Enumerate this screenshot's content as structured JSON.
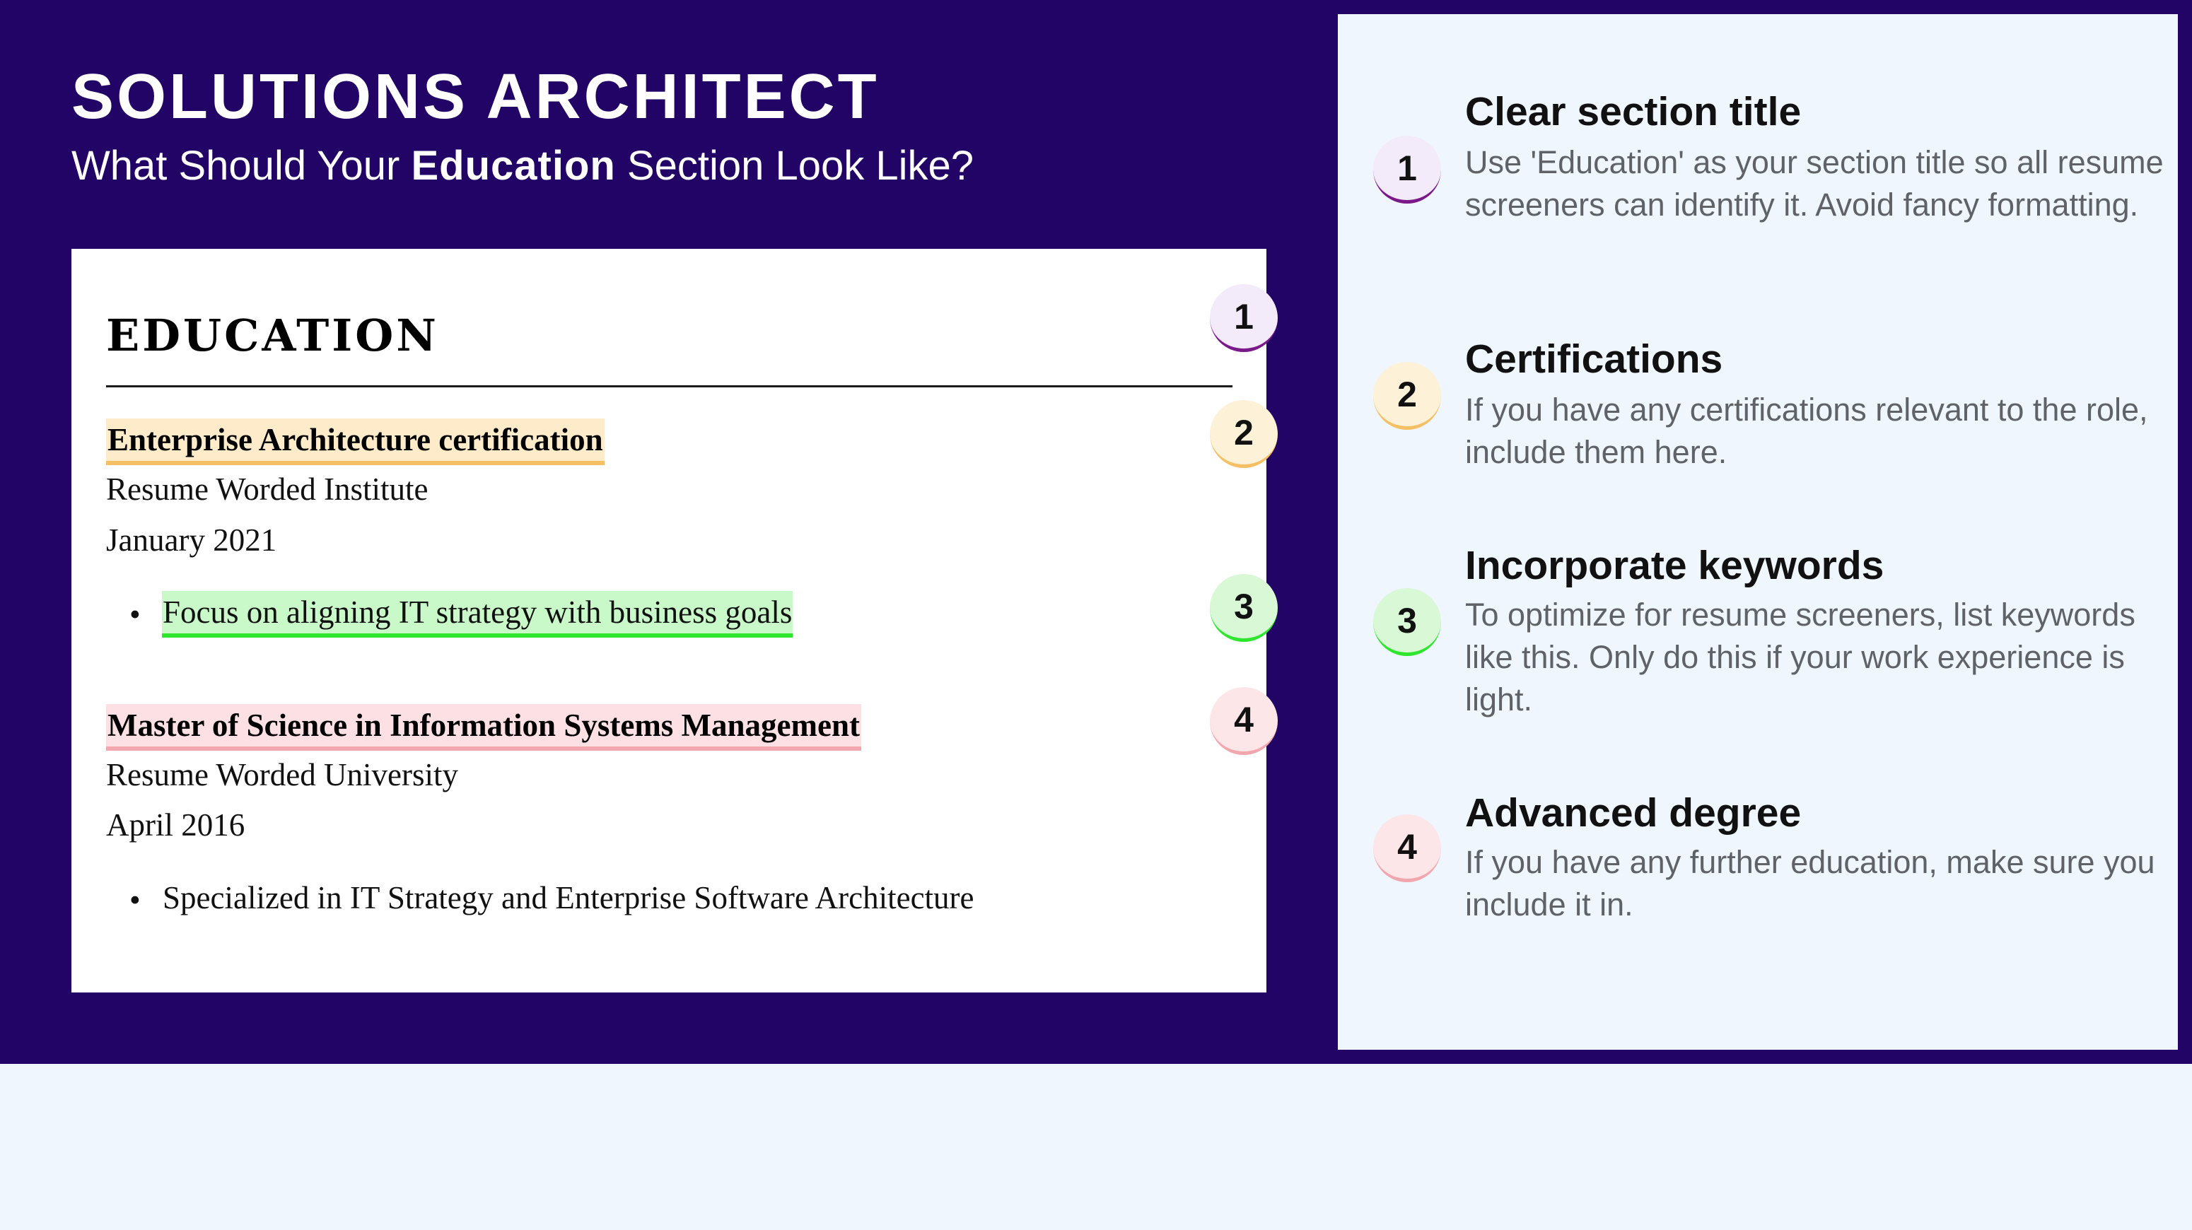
{
  "header": {
    "title": "SOLUTIONS ARCHITECT",
    "subtitle_before": "What Should Your ",
    "subtitle_bold": "Education",
    "subtitle_after": " Section Look Like?"
  },
  "resume": {
    "section_heading": "EDUCATION",
    "entries": [
      {
        "title": "Enterprise Architecture certification",
        "institution": "Resume Worded Institute",
        "date": "January 2021",
        "bullet": "Focus on aligning IT strategy with business goals"
      },
      {
        "title": "Master of Science in Information Systems Management",
        "institution": "Resume Worded University",
        "date": "April 2016",
        "bullet": "Specialized in IT Strategy and Enterprise Software Architecture"
      }
    ],
    "badges": [
      "1",
      "2",
      "3",
      "4"
    ]
  },
  "tips": [
    {
      "number": "1",
      "title": "Clear section title",
      "body": "Use 'Education' as your section title so all resume screeners can identify it. Avoid fancy formatting."
    },
    {
      "number": "2",
      "title": "Certifications",
      "body": "If you have any certifications relevant to the role, include them here."
    },
    {
      "number": "3",
      "title": "Incorporate keywords",
      "body": "To optimize for resume screeners, list keywords like this. Only do this if your work experience is light."
    },
    {
      "number": "4",
      "title": "Advanced degree",
      "body": "If you have any further education, make sure you include it in."
    }
  ],
  "colors": {
    "banner": "#220466",
    "panel": "#eff6fd",
    "badge1": "#7a1a8a",
    "badge2": "#f5bf63",
    "badge3": "#2ee62e",
    "badge4": "#f2a6ad"
  }
}
